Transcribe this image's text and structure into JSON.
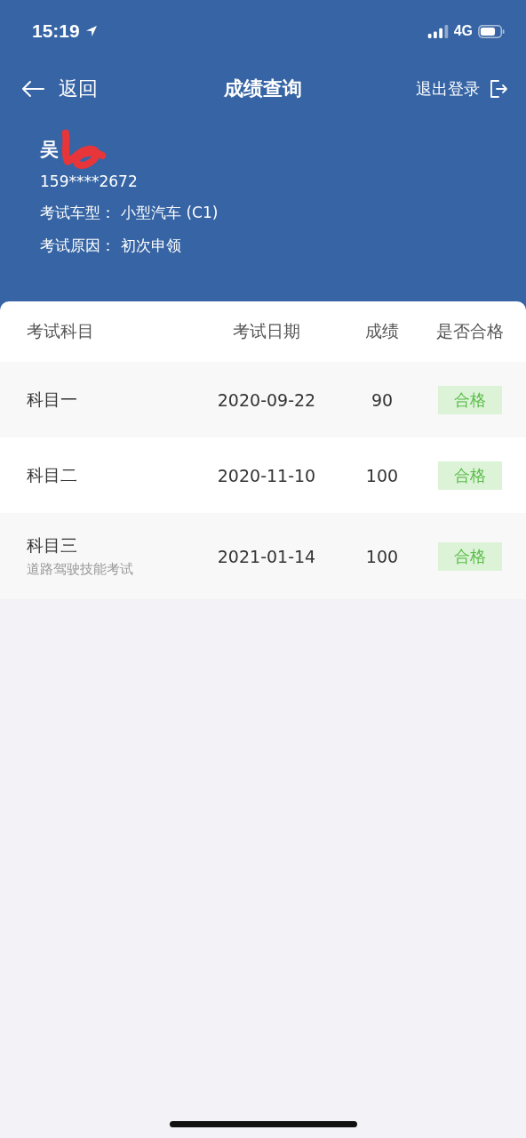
{
  "status_bar": {
    "time": "15:19",
    "network": "4G"
  },
  "nav": {
    "back": "返回",
    "title": "成绩查询",
    "logout": "退出登录"
  },
  "profile": {
    "name": "吴",
    "name_redacted": true,
    "phone": "159****2672",
    "fields": [
      {
        "label": "考试车型：",
        "value": "小型汽车 (C1)"
      },
      {
        "label": "考试原因：",
        "value": "初次申领"
      }
    ]
  },
  "table": {
    "columns": [
      "考试科目",
      "考试日期",
      "成绩",
      "是否合格"
    ],
    "rows": [
      {
        "subject": "科目一",
        "date": "2020-09-22",
        "score": "90",
        "result": "合格",
        "passed": true
      },
      {
        "subject": "科目二",
        "date": "2020-11-10",
        "score": "100",
        "result": "合格",
        "passed": true
      },
      {
        "subject": "科目三",
        "note": "道路驾驶技能考试",
        "date": "2021-01-14",
        "score": "100",
        "result": "合格",
        "passed": true
      }
    ]
  }
}
